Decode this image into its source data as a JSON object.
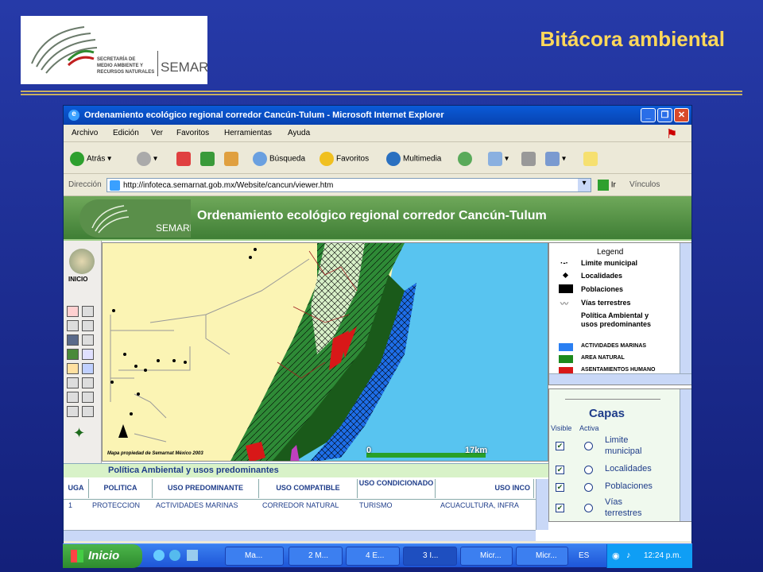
{
  "slide": {
    "title": "Bitácora ambiental",
    "logo_text_line1": "SECRETARÍA DE",
    "logo_text_line2": "MEDIO AMBIENTE Y",
    "logo_text_line3": "RECURSOS NATURALES",
    "logo_brand": "SEMARNAT"
  },
  "browser": {
    "window_title": "Ordenamiento ecológico regional corredor Cancún-Tulum - Microsoft Internet Explorer",
    "menu": [
      "Archivo",
      "Edición",
      "Ver",
      "Favoritos",
      "Herramientas",
      "Ayuda"
    ],
    "toolbar": {
      "back": "Atrás",
      "search": "Búsqueda",
      "favorites": "Favoritos",
      "media": "Multimedia"
    },
    "address_label": "Dirección",
    "address_value": "http://infoteca.semarnat.gob.mx/Website/cancun/viewer.htm",
    "go_label": "Ir",
    "links_label": "Vínculos"
  },
  "page": {
    "banner_title": "Ordenamiento ecológico regional corredor Cancún-Tulum",
    "banner_logo_brand": "SEMARNAT",
    "home_label": "INICIO",
    "map_credit": "Mapa propiedad de Semarnat México 2003",
    "scale_start": "0",
    "scale_end": "17km",
    "legend": {
      "title": "Legend",
      "items": [
        "Limite municipal",
        "Localidades",
        "Poblaciones",
        "Vías terrestres"
      ],
      "section_line1": "Política Ambiental y",
      "section_line2": "usos predominantes",
      "classes": [
        {
          "label": "ACTIVIDADES MARINAS",
          "color": "#2a7ff2"
        },
        {
          "label": "AREA NATURAL",
          "color": "#1c8a1c"
        },
        {
          "label": "ASENTAMIENTOS HUMANO",
          "color": "#d81818"
        }
      ]
    },
    "capas": {
      "title": "Capas",
      "visible_label": "Visible",
      "active_label": "Activa",
      "layers": [
        {
          "line1": "Limite",
          "line2": "municipal"
        },
        {
          "line1": "Localidades",
          "line2": ""
        },
        {
          "line1": "Poblaciones",
          "line2": ""
        },
        {
          "line1": "Vías",
          "line2": "terrestres"
        }
      ]
    },
    "table": {
      "title": "Política Ambiental y usos predominantes",
      "headers": [
        "UGA",
        "POLITICA",
        "USO PREDOMINANTE",
        "USO COMPATIBLE",
        "USO CONDICIONADO",
        "USO INCO"
      ],
      "row": [
        "1",
        "PROTECCION",
        "ACTIVIDADES MARINAS",
        "CORREDOR NATURAL",
        "TURISMO",
        "ACUACULTURA, INFRA"
      ]
    }
  },
  "taskbar": {
    "start_label": "Inicio",
    "tasks": [
      "Ma...",
      "2 M...",
      "4 E...",
      "3 I...",
      "Micr...",
      "Micr..."
    ],
    "lang": "ES",
    "clock": "12:24 p.m."
  }
}
